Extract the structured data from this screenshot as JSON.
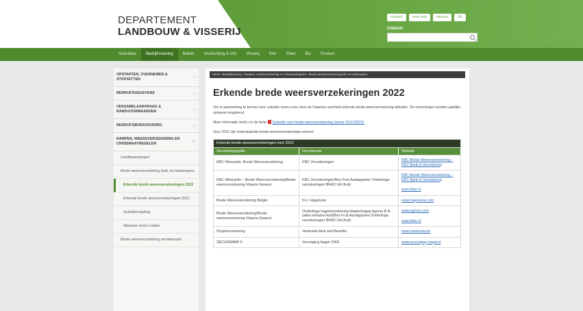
{
  "header": {
    "logo_line1": "DEPARTEMENT",
    "logo_line2": "LANDBOUW & VISSERIJ",
    "top_links": [
      "contact",
      "over ons",
      "nieuws",
      "NL"
    ],
    "search_label": "ZOEKEN",
    "search_placeholder": ""
  },
  "nav": {
    "items": [
      "Subsidies",
      "Bedrijfsvoering",
      "Beleid",
      "Voorlichting & info",
      "Visserij",
      "Dier",
      "Plant",
      "Bio",
      "Product"
    ],
    "active_index": 1
  },
  "sidebar": {
    "items": [
      {
        "label": "OPSTARTEN, OVERNEMEN & STOPZETTEN",
        "type": "top"
      },
      {
        "label": "BEDRIJFSGEGEVENS",
        "type": "top"
      },
      {
        "label": "VERZAMELAANVRAAG & RANDVOORWAARDEN",
        "type": "top"
      },
      {
        "label": "BEDRIJFSBOEKHOUDING",
        "type": "top"
      },
      {
        "label": "RAMPEN, WEERSVERZEKERING EN CRISISMAATREGELEN",
        "type": "top"
      },
      {
        "label": "Landbouwrampen",
        "type": "sub"
      },
      {
        "label": "Brede weersverzekering land- en tuinbouwers",
        "type": "sub"
      },
      {
        "label": "Erkende brede weersverzekeringen 2022",
        "type": "deep-active"
      },
      {
        "label": "Erkende brede weersverzekeringen 2021",
        "type": "deep"
      },
      {
        "label": "Subsidieregeling",
        "type": "deep"
      },
      {
        "label": "Wanneer moet u letten",
        "type": "deep"
      },
      {
        "label": "Brede weersverzekering verzekeraars",
        "type": "sub"
      }
    ]
  },
  "main": {
    "breadcrumb": "Home › Bedrijfsvoering › Rampen, weersverzekering en crisismaatregelen › Brede weersverzekering land- en tuinbouwers",
    "title": "Erkende brede weersverzekeringen 2022",
    "para1": "Om in aanmerking te komen voor subsidie moet u een door de Vlaamse overheid erkende brede weersverzekering afsluiten. De erkenningen worden jaarlijks opnieuw toegekend.",
    "para2_prefix": "Meer informatie vindt u in de fiche",
    "para2_link": "Subsidie voor brede weersverzekering (versie 21/12/2022)",
    "para3": "Voor 2022 zijn onderstaande brede weersverzekeringen erkend:"
  },
  "table": {
    "caption": "Erkende brede weersverzekeringen voor 2022",
    "headers": [
      "Verzekeringspolis",
      "Verzekeraar",
      "Website"
    ],
    "rows": [
      {
        "polis": "KBC Weerpolis, Brede Weersverzekering",
        "verzekeraar": "KBC Verzekeringen",
        "websites": [
          "KBC-Brede Weersverzekering – KBC Bank & Verzekering"
        ]
      },
      {
        "polis": "KBC Weerpolis – Brede Weersverzekering/Brede weersverzekering Vlaams Gewest",
        "verzekeraar": "KBC Verzekeringen/Bos Fruit Aardappelen Onderlinge verzekeringen BFAO UA (fruit)",
        "websites": [
          "KBC-Brede Weersverzekering – KBC Bank & Verzekering",
          "www.bfao.nl"
        ]
      },
      {
        "polis": "Brede Weersverzekering België",
        "verzekeraar": "N.V. Hagelunie",
        "websites": [
          "www.hagelunie.com"
        ]
      },
      {
        "polis": "Brede Weersverzekering/Brede weersverzekering Vlaams Gewest",
        "verzekeraar": "Onderlinge hagelverzekering Maatschappij Agriver B.A. (alles behalve fruit)/Bos Fruit Aardappelen Onderlinge verzekeringen BFAO UA (fruit)",
        "websites": [
          "www.agriver.com",
          "www.bfao.nl"
        ]
      },
      {
        "polis": "Oogstverzekering",
        "verzekeraar": "Vanbreda Risk and Benefits",
        "websites": [
          "www.vanbreda.be"
        ]
      },
      {
        "polis": "SECUFARM® 6",
        "verzekeraar": "Vereniging Hagel VWG",
        "websites": [
          "www.vereniging-hagel.nl"
        ]
      }
    ]
  }
}
